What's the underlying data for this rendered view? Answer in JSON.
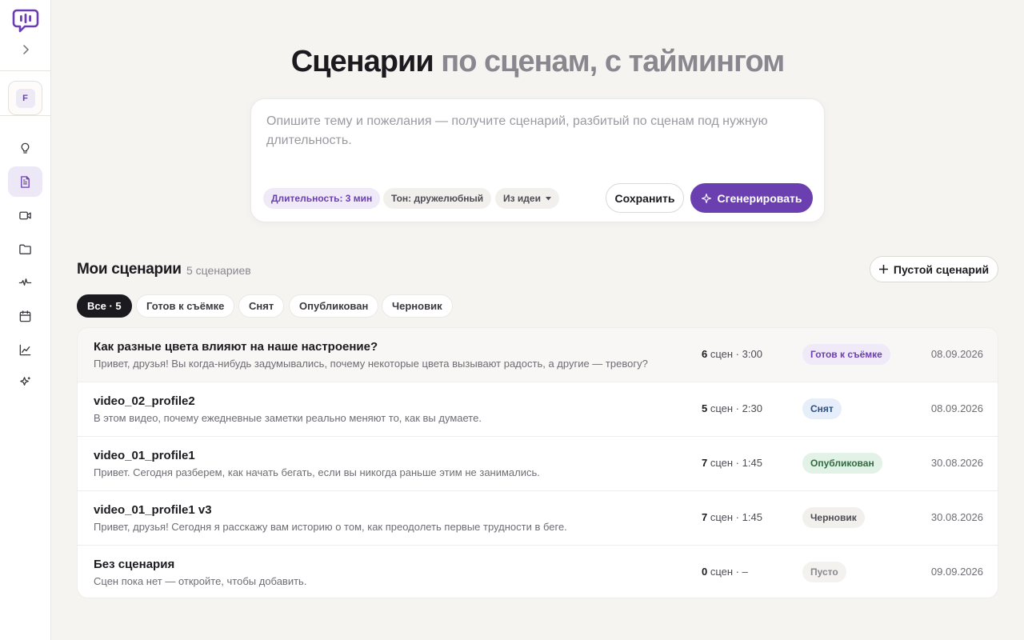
{
  "workspace": {
    "initial": "F"
  },
  "hero": {
    "title_strong": "Сценарии",
    "title_muted": "по сценам, с таймингом",
    "placeholder": "Опишите тему и пожелания — получите сценарий, разбитый по сценам под нужную длительность.",
    "chip_duration": "Длительность: 3 мин",
    "chip_tone": "Тон: дружелюбный",
    "chip_source": "Из идеи",
    "save_label": "Сохранить",
    "generate_label": "Сгенерировать"
  },
  "section": {
    "title": "Мои сценарии",
    "count": "5 сценариев",
    "empty_button": "Пустой сценарий"
  },
  "filters": [
    "Все · 5",
    "Готов к съёмке",
    "Снят",
    "Опубликован",
    "Черновик"
  ],
  "rows": [
    {
      "title": "Как разные цвета влияют на наше настроение?",
      "desc": "Привет, друзья! Вы когда-нибудь задумывались, почему некоторые цвета вызывают радость, а другие — тревогу?",
      "scenes": "6",
      "meta": "сцен · 3:00",
      "status": "Готов к съёмке",
      "date": "08.09.2026"
    },
    {
      "title": "video_02_profile2",
      "desc": "В этом видео, почему ежедневные заметки реально меняют то, как вы думаете.",
      "scenes": "5",
      "meta": "сцен · 2:30",
      "status": "Снят",
      "date": "08.09.2026"
    },
    {
      "title": "video_01_profile1",
      "desc": "Привет. Сегодня разберем, как начать бегать, если вы никогда раньше этим не занимались.",
      "scenes": "7",
      "meta": "сцен · 1:45",
      "status": "Опубликован",
      "date": "30.08.2026"
    },
    {
      "title": "video_01_profile1 v3",
      "desc": "Привет, друзья! Сегодня я расскажу вам историю о том, как преодолеть первые трудности в беге.",
      "scenes": "7",
      "meta": "сцен · 1:45",
      "status": "Черновик",
      "date": "30.08.2026"
    },
    {
      "title": "Без сценария",
      "desc": "Сцен пока нет — откройте, чтобы добавить.",
      "scenes": "0",
      "meta": "сцен · –",
      "status": "Пусто",
      "date": "09.09.2026"
    }
  ],
  "colors": {
    "accent": "#6b3fb0",
    "status_ready_bg": "#efe9f8",
    "status_ready_fg": "#6b3fb0",
    "status_shot_bg": "#e6eefa",
    "status_shot_fg": "#2d4f86",
    "status_published_bg": "#e2f2e6",
    "status_published_fg": "#2f6b3f",
    "status_draft_bg": "#f1f0ed",
    "status_draft_fg": "#4f4d54",
    "status_empty_bg": "#f3f2ef",
    "status_empty_fg": "#8a878f"
  }
}
